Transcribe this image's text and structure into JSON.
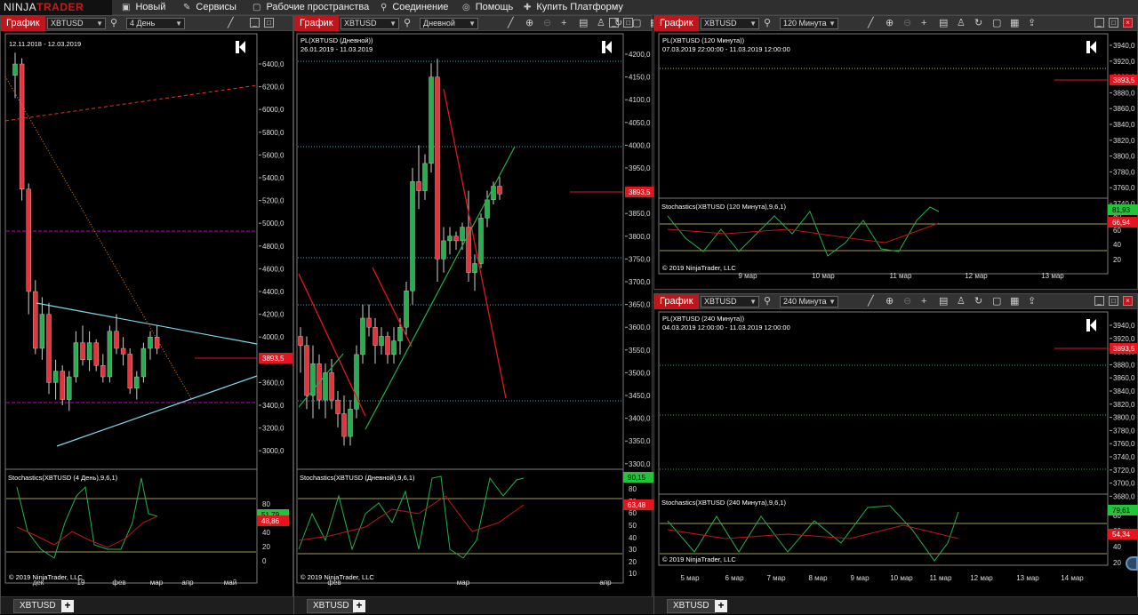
{
  "app": {
    "logo_a": "NINJA",
    "logo_b": "TRADER"
  },
  "menu": [
    {
      "icon": "new-icon",
      "glyph": "▣",
      "label": "Новый"
    },
    {
      "icon": "tools-icon",
      "glyph": "✎",
      "label": "Сервисы"
    },
    {
      "icon": "workspace-icon",
      "glyph": "▢",
      "label": "Рабочие пространства"
    },
    {
      "icon": "connect-icon",
      "glyph": "⚲",
      "label": "Соединение"
    },
    {
      "icon": "help-icon",
      "glyph": "◎",
      "label": "Помощь"
    },
    {
      "icon": "cart-icon",
      "glyph": "✚",
      "label": "Купить Платформу"
    }
  ],
  "colors": {
    "up": "#22b14c",
    "down": "#e8323c",
    "wick": "#cfcfcf",
    "stoch_k": "#22b14c",
    "stoch_d": "#c0161b",
    "price_line": "#e3161f"
  },
  "windows": [
    {
      "id": "w1",
      "title": "График",
      "instrument": "XBTUSD",
      "period": "4 День",
      "range": "12.11.2018 - 12.03.2019",
      "stoch_title": "Stochastics(XBTUSD (4 День),9,6,1)",
      "copyright": "© 2019 NinjaTrader, LLC",
      "price_ticks": [
        "6400,0",
        "6200,0",
        "6000,0",
        "5800,0",
        "5600,0",
        "5400,0",
        "5200,0",
        "5000,0",
        "4800,0",
        "4600,0",
        "4400,0",
        "4200,0",
        "4000,0",
        "3800,0",
        "3600,0",
        "3400,0",
        "3200,0",
        "3000,0"
      ],
      "price_label": "3893,5",
      "stoch_ticks": [
        "80",
        "60",
        "40",
        "20",
        "0"
      ],
      "stoch_labels": [
        "51,79",
        "48,86"
      ],
      "x_labels": [
        "дек",
        "19",
        "фев",
        "мар",
        "апр",
        "май"
      ],
      "tab": "XBTUSD"
    },
    {
      "id": "w2",
      "title": "График",
      "instrument": "XBTUSD",
      "period": "Дневной",
      "name": "PL(XBTUSD (Дневной))",
      "range": "26.01.2019 - 11.03.2019",
      "stoch_title": "Stochastics(XBTUSD (Дневной),9,6,1)",
      "copyright": "© 2019 NinjaTrader, LLC",
      "price_ticks": [
        "4200,0",
        "4150,0",
        "4100,0",
        "4050,0",
        "4000,0",
        "3950,0",
        "3900,0",
        "3850,0",
        "3800,0",
        "3750,0",
        "3700,0",
        "3650,0",
        "3600,0",
        "3550,0",
        "3500,0",
        "3450,0",
        "3400,0",
        "3350,0",
        "3300,0"
      ],
      "price_label": "3893,5",
      "stoch_ticks": [
        "80",
        "70",
        "60",
        "50",
        "40",
        "30",
        "20",
        "10"
      ],
      "stoch_labels": [
        "90,15",
        "63,48"
      ],
      "x_labels": [
        "фев",
        "мар",
        "апр"
      ],
      "tab": "XBTUSD"
    },
    {
      "id": "w3",
      "title": "График",
      "instrument": "XBTUSD",
      "period": "120 Минута",
      "name": "PL(XBTUSD (120 Минута))",
      "range": "07.03.2019 22:00:00 - 11.03.2019 12:00:00",
      "stoch_title": "Stochastics(XBTUSD (120 Минута),9,6,1)",
      "copyright": "© 2019 NinjaTrader, LLC",
      "price_ticks": [
        "3940,0",
        "3920,0",
        "3900,0",
        "3880,0",
        "3860,0",
        "3840,0",
        "3820,0",
        "3800,0",
        "3780,0",
        "3760,0",
        "3740,0"
      ],
      "price_label": "3893,5",
      "stoch_ticks": [
        "80",
        "60",
        "40",
        "20"
      ],
      "stoch_labels": [
        "81,93",
        "66,94"
      ],
      "x_labels": [
        "9 мар",
        "10 мар",
        "11 мар",
        "12 мар",
        "13 мар"
      ]
    },
    {
      "id": "w4",
      "title": "График",
      "instrument": "XBTUSD",
      "period": "240 Минута",
      "name": "PL(XBTUSD (240 Минута))",
      "range": "04.03.2019 12:00:00 - 11.03.2019 12:00:00",
      "stoch_title": "Stochastics(XBTUSD (240 Минута),9,6,1)",
      "copyright": "© 2019 NinjaTrader, LLC",
      "price_ticks": [
        "3940,0",
        "3920,0",
        "3900,0",
        "3880,0",
        "3860,0",
        "3840,0",
        "3820,0",
        "3800,0",
        "3780,0",
        "3760,0",
        "3740,0",
        "3720,0",
        "3700,0",
        "3680,0"
      ],
      "price_label": "3893,5",
      "stoch_ticks": [
        "80",
        "60",
        "40",
        "20"
      ],
      "stoch_labels": [
        "79,61",
        "54,34"
      ],
      "x_labels": [
        "5 мар",
        "6 мар",
        "7 мар",
        "8 мар",
        "9 мар",
        "10 мар",
        "11 мар",
        "12 мар",
        "13 мар",
        "14 мар"
      ],
      "tab": "XBTUSD"
    }
  ],
  "chart_data": [
    {
      "chart": "w1",
      "type": "candlestick",
      "price": 3893.5,
      "candles_ohlc": [
        [
          6300,
          6500,
          6100,
          6400
        ],
        [
          6400,
          6450,
          5200,
          5300
        ],
        [
          5300,
          5350,
          4200,
          4400
        ],
        [
          4400,
          4500,
          3850,
          3900
        ],
        [
          3900,
          4350,
          3800,
          4200
        ],
        [
          4200,
          4300,
          3500,
          3600
        ],
        [
          3600,
          3800,
          3450,
          3700
        ],
        [
          3700,
          3750,
          3400,
          3450
        ],
        [
          3450,
          3700,
          3350,
          3650
        ],
        [
          3650,
          4050,
          3600,
          3950
        ],
        [
          3950,
          4100,
          3750,
          3800
        ],
        [
          3800,
          4050,
          3700,
          3950
        ],
        [
          3950,
          3980,
          3700,
          3750
        ],
        [
          3750,
          3850,
          3600,
          3650
        ],
        [
          3650,
          4100,
          3600,
          4050
        ],
        [
          4050,
          4200,
          3850,
          3900
        ],
        [
          3900,
          4000,
          3750,
          3850
        ],
        [
          3850,
          3900,
          3500,
          3550
        ],
        [
          3550,
          3700,
          3450,
          3650
        ],
        [
          3650,
          3950,
          3600,
          3900
        ],
        [
          3900,
          4050,
          3800,
          4000
        ],
        [
          4000,
          4100,
          3850,
          3900
        ]
      ]
    },
    {
      "chart": "w2",
      "type": "candlestick",
      "price": 3893.5,
      "candles_ohlc": [
        [
          3580,
          3600,
          3500,
          3560
        ],
        [
          3560,
          3580,
          3420,
          3450
        ],
        [
          3450,
          3560,
          3400,
          3520
        ],
        [
          3520,
          3540,
          3420,
          3440
        ],
        [
          3440,
          3520,
          3400,
          3500
        ],
        [
          3500,
          3530,
          3420,
          3440
        ],
        [
          3440,
          3460,
          3380,
          3410
        ],
        [
          3410,
          3450,
          3340,
          3360
        ],
        [
          3360,
          3440,
          3340,
          3420
        ],
        [
          3420,
          3560,
          3400,
          3540
        ],
        [
          3540,
          3650,
          3520,
          3620
        ],
        [
          3620,
          3650,
          3580,
          3600
        ],
        [
          3600,
          3620,
          3520,
          3560
        ],
        [
          3560,
          3600,
          3540,
          3580
        ],
        [
          3580,
          3590,
          3520,
          3540
        ],
        [
          3540,
          3600,
          3520,
          3570
        ],
        [
          3570,
          3620,
          3540,
          3600
        ],
        [
          3600,
          3700,
          3580,
          3680
        ],
        [
          3680,
          3950,
          3650,
          3920
        ],
        [
          3920,
          4000,
          3860,
          3900
        ],
        [
          3900,
          3980,
          3880,
          3960
        ],
        [
          3960,
          4180,
          3940,
          4150
        ],
        [
          4150,
          4190,
          3700,
          3750
        ],
        [
          3750,
          3820,
          3720,
          3790
        ],
        [
          3790,
          3820,
          3760,
          3800
        ],
        [
          3800,
          3810,
          3770,
          3790
        ],
        [
          3790,
          3830,
          3770,
          3820
        ],
        [
          3820,
          3900,
          3700,
          3720
        ],
        [
          3720,
          3760,
          3680,
          3740
        ],
        [
          3740,
          3850,
          3730,
          3840
        ],
        [
          3840,
          3900,
          3820,
          3880
        ],
        [
          3880,
          3920,
          3870,
          3910
        ],
        [
          3910,
          3930,
          3880,
          3893
        ]
      ]
    }
  ]
}
